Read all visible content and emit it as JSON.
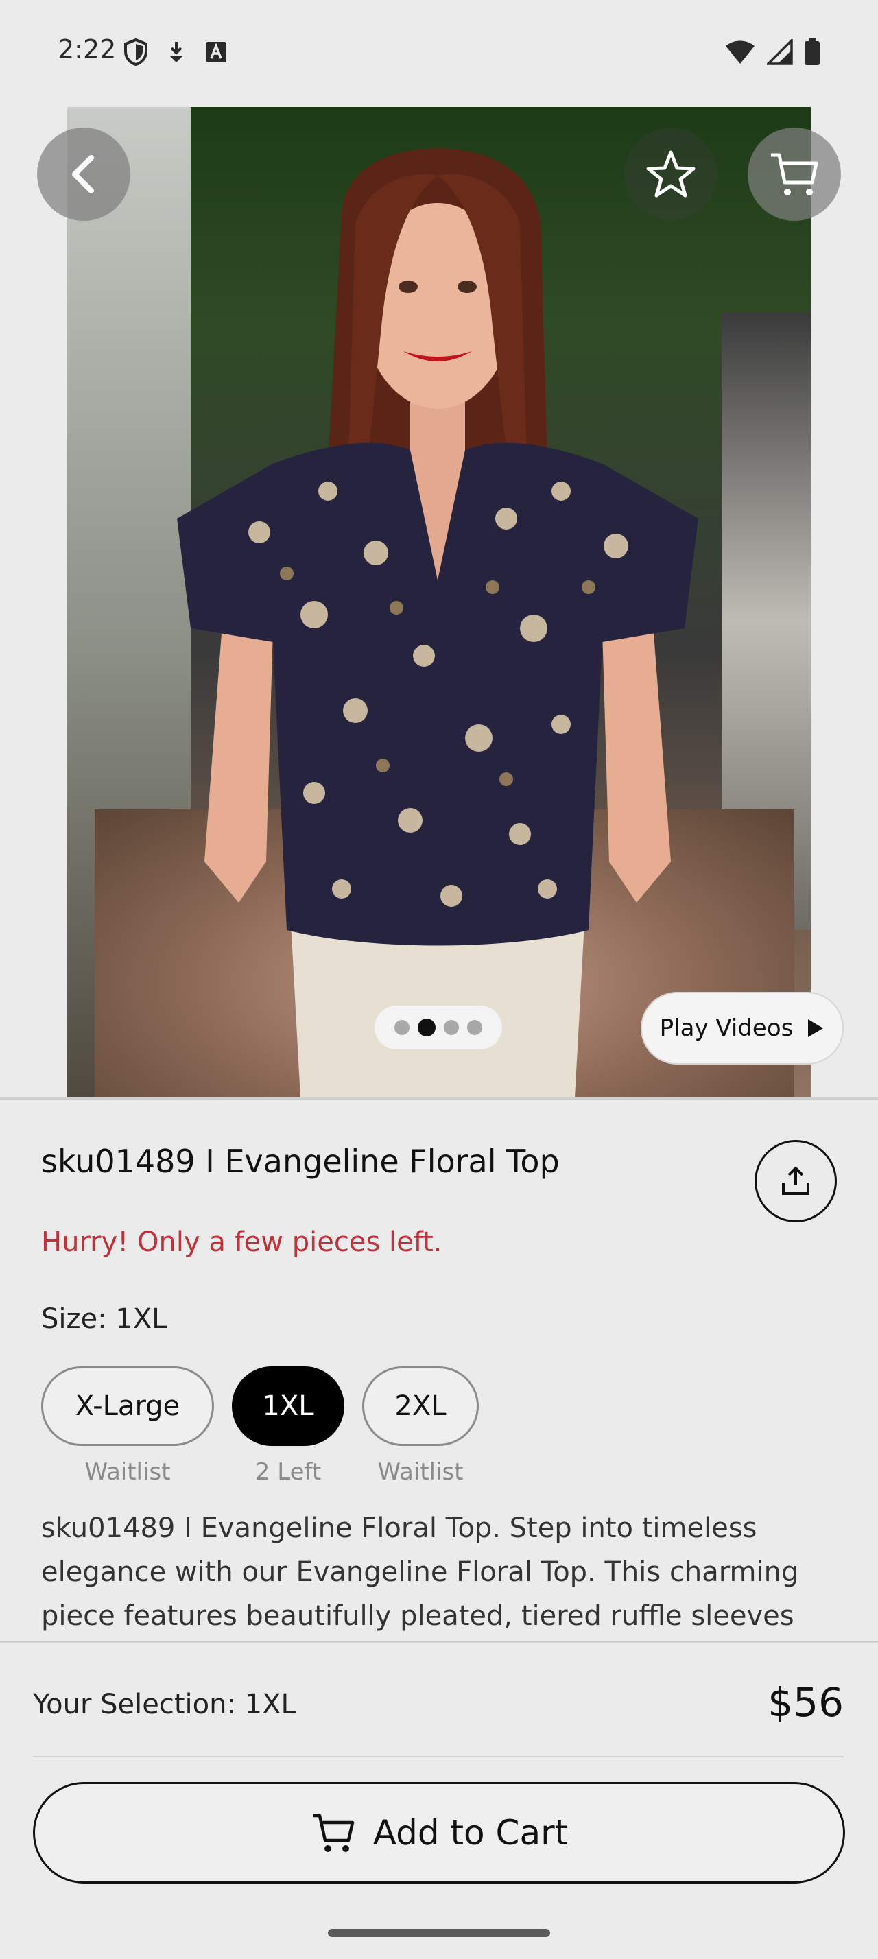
{
  "status_bar": {
    "time": "2:22",
    "icons_left": [
      "shield-icon",
      "download-icon",
      "font-icon"
    ],
    "icons_right": [
      "wifi-icon",
      "signal-icon",
      "battery-icon"
    ]
  },
  "product_image": {
    "carousel": {
      "total": 4,
      "active_index": 1
    },
    "play_videos_label": "Play Videos"
  },
  "product": {
    "title": "sku01489 I Evangeline Floral Top",
    "urgency_text": "Hurry! Only a few pieces left.",
    "size_label": "Size: 1XL",
    "sizes": [
      {
        "label": "X-Large",
        "availability": "Waitlist",
        "selected": false
      },
      {
        "label": "1XL",
        "availability": "2 Left",
        "selected": true
      },
      {
        "label": "2XL",
        "availability": "Waitlist",
        "selected": false
      }
    ],
    "description": "sku01489 I Evangeline Floral Top. Step into timeless elegance with our Evangeline Floral Top. This charming piece features beautifully pleated, tiered ruffle sleeves and"
  },
  "footer": {
    "selection_text": "Your Selection: 1XL",
    "price": "$56",
    "add_to_cart_label": "Add to Cart"
  },
  "colors": {
    "urgency": "#c0313b",
    "selected_chip": "#000000",
    "background": "#ebebeb"
  }
}
